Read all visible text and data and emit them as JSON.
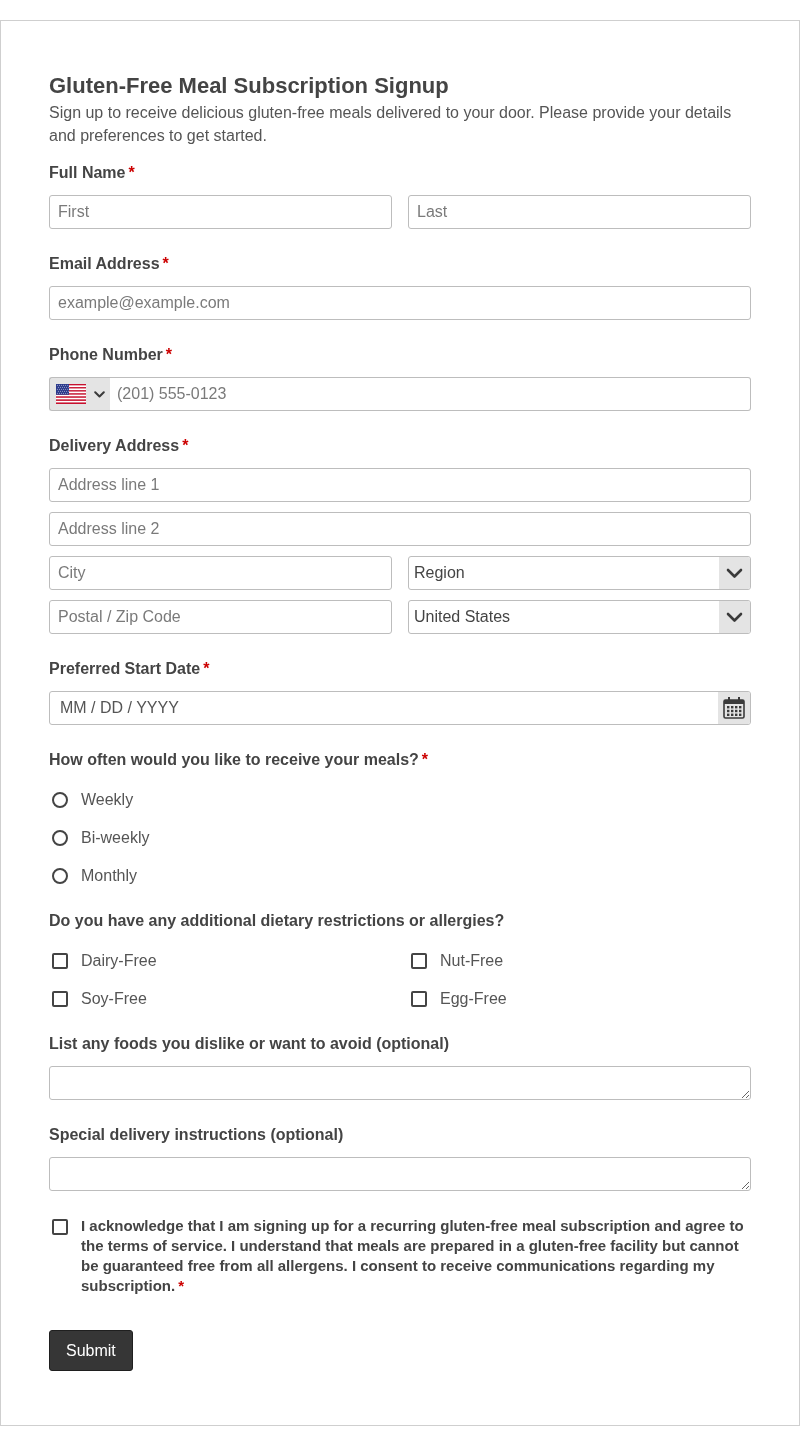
{
  "form": {
    "title": "Gluten-Free Meal Subscription Signup",
    "description": "Sign up to receive delicious gluten-free meals delivered to your door. Please provide your details and preferences to get started."
  },
  "fields": [
    {
      "kind": "name",
      "label": "Full Name",
      "required_mark": "*",
      "inputs": [
        {
          "placeholder": "First"
        },
        {
          "placeholder": "Last"
        }
      ]
    },
    {
      "kind": "text",
      "label": "Email Address",
      "required_mark": "*",
      "placeholder": "example@example.com"
    },
    {
      "kind": "phone",
      "label": "Phone Number",
      "required_mark": "*",
      "placeholder": "(201) 555-0123"
    },
    {
      "kind": "address",
      "label": "Delivery Address",
      "required_mark": "*",
      "rows": [
        [
          {
            "kind": "text",
            "placeholder": "Address line 1"
          }
        ],
        [
          {
            "kind": "text",
            "placeholder": "Address line 2"
          }
        ],
        [
          {
            "kind": "text",
            "placeholder": "City"
          },
          {
            "kind": "select",
            "value": "Region"
          }
        ],
        [
          {
            "kind": "text",
            "placeholder": "Postal / Zip Code"
          },
          {
            "kind": "select",
            "value": "United States"
          }
        ]
      ]
    },
    {
      "kind": "date",
      "label": "Preferred Start Date",
      "required_mark": "*",
      "placeholder": "MM / DD / YYYY"
    },
    {
      "kind": "radio",
      "label": "How often would you like to receive your meals?",
      "required_mark": "*",
      "options": [
        {
          "label": "Weekly",
          "selected": false
        },
        {
          "label": "Bi-weekly",
          "selected": false
        },
        {
          "label": "Monthly",
          "selected": false
        }
      ]
    },
    {
      "kind": "checkbox",
      "label": "Do you have any additional dietary restrictions or allergies?",
      "options": [
        {
          "label": "Dairy-Free",
          "checked": false
        },
        {
          "label": "Nut-Free",
          "checked": false
        },
        {
          "label": "Soy-Free",
          "checked": false
        },
        {
          "label": "Egg-Free",
          "checked": false
        }
      ]
    },
    {
      "kind": "textarea",
      "label": "List any foods you dislike or want to avoid (optional)"
    },
    {
      "kind": "textarea",
      "label": "Special delivery instructions (optional)"
    },
    {
      "kind": "consent",
      "text": "I acknowledge that I am signing up for a recurring gluten-free meal subscription and agree to the terms of service. I understand that meals are prepared in a gluten-free facility but cannot be guaranteed free from all allergens. I consent to receive communications regarding my subscription.",
      "required_mark": "*",
      "checked": false
    }
  ],
  "submit": {
    "label": "Submit"
  }
}
